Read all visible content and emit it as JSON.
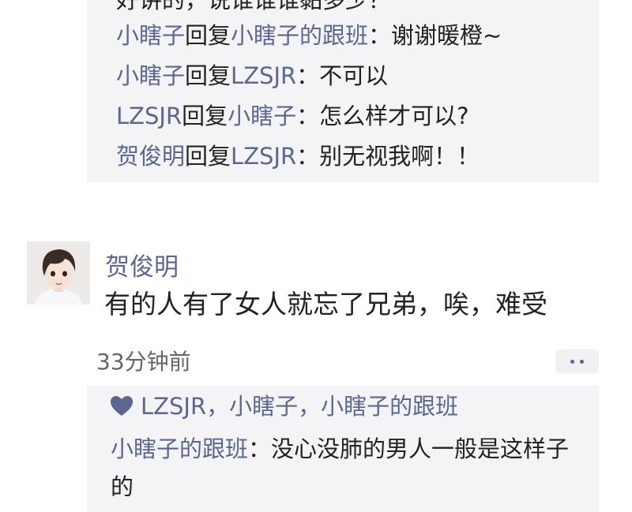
{
  "thread1": {
    "cut_line": "好讲的，说谁谁谁黏多少？",
    "replies": [
      {
        "from": "小瞎子",
        "verb": "回复",
        "to": "小瞎子的跟班",
        "text": "：谢谢暖橙~"
      },
      {
        "from": "小瞎子",
        "verb": "回复",
        "to": "LZSJR",
        "text": "：不可以"
      },
      {
        "from": "LZSJR",
        "verb": "回复",
        "to": "小瞎子",
        "text": "：怎么样才可以?"
      },
      {
        "from": "贺俊明",
        "verb": "回复",
        "to": "LZSJR",
        "text": "：别无视我啊！！"
      }
    ]
  },
  "post": {
    "author": "贺俊明",
    "text": "有的人有了女人就忘了兄弟，唉，难受",
    "time": "33分钟前"
  },
  "likes": {
    "names": "LZSJR，小瞎子，小瞎子的跟班"
  },
  "thread2": {
    "reply_from": "小瞎子的跟班",
    "reply_text": "：没心没肺的男人一般是这样子的"
  },
  "colors": {
    "name": "#5d6690",
    "bubble": "#f4f4f7"
  }
}
